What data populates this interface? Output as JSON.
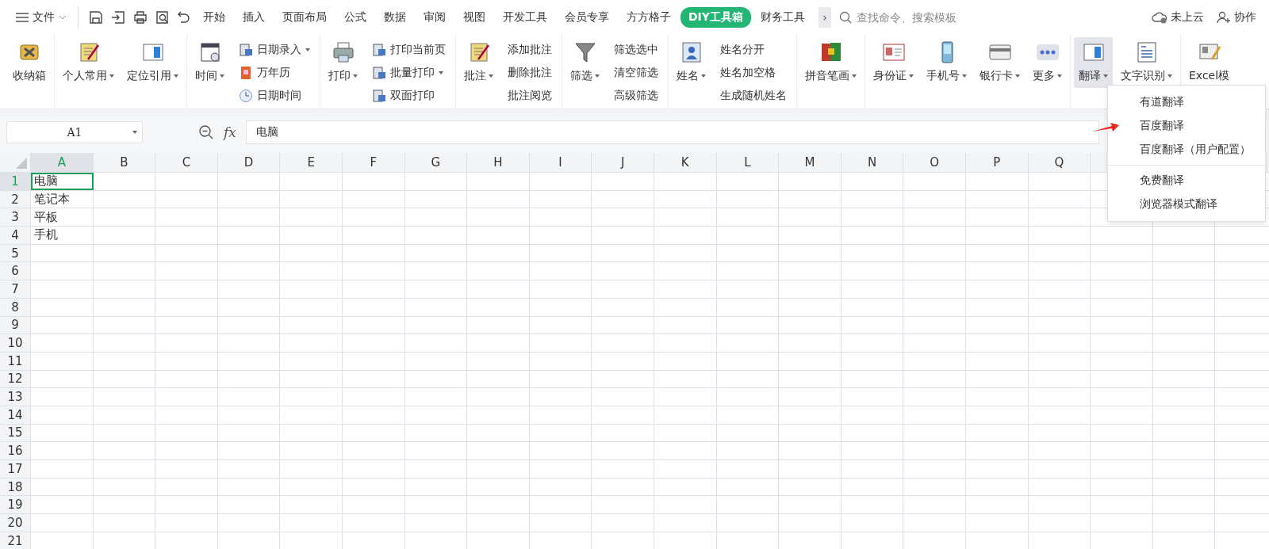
{
  "menu_bar": {
    "file_label": "文件",
    "tabs": [
      {
        "label": "开始",
        "selected": false
      },
      {
        "label": "插入",
        "selected": false
      },
      {
        "label": "页面布局",
        "selected": false
      },
      {
        "label": "公式",
        "selected": false
      },
      {
        "label": "数据",
        "selected": false
      },
      {
        "label": "审阅",
        "selected": false
      },
      {
        "label": "视图",
        "selected": false
      },
      {
        "label": "开发工具",
        "selected": false
      },
      {
        "label": "会员专享",
        "selected": false
      },
      {
        "label": "方方格子",
        "selected": false
      },
      {
        "label": "DIY工具箱",
        "selected": true
      },
      {
        "label": "财务工具",
        "selected": false
      }
    ],
    "more": "›",
    "search": {
      "placeholder": "查找命令、搜索模板"
    },
    "cloud": "未上云",
    "collab": "协作"
  },
  "ribbon": {
    "groups": [
      {
        "items": [
          {
            "kind": "large",
            "label": "收纳箱",
            "dropdown": false,
            "pressed": false
          }
        ]
      },
      {
        "items": [
          {
            "kind": "large",
            "label": "个人常用",
            "dropdown": true,
            "pressed": false
          },
          {
            "kind": "large",
            "label": "定位引用",
            "dropdown": true,
            "pressed": false
          }
        ]
      },
      {
        "items": [
          {
            "kind": "large",
            "label": "时间",
            "dropdown": true,
            "pressed": false
          },
          {
            "kind": "icon_stack",
            "rows": [
              {
                "label": "日期录入",
                "dropdown": true
              },
              {
                "label": "万年历",
                "dropdown": false
              },
              {
                "label": "日期时间",
                "dropdown": false
              }
            ]
          }
        ]
      },
      {
        "items": [
          {
            "kind": "large",
            "label": "打印",
            "dropdown": true,
            "pressed": false
          },
          {
            "kind": "icon_stack",
            "rows": [
              {
                "label": "打印当前页",
                "dropdown": false
              },
              {
                "label": "批量打印",
                "dropdown": true
              },
              {
                "label": "双面打印",
                "dropdown": false
              }
            ]
          }
        ]
      },
      {
        "items": [
          {
            "kind": "large",
            "label": "批注",
            "dropdown": true,
            "pressed": false
          },
          {
            "kind": "text_stack",
            "rows": [
              {
                "label": "添加批注",
                "dropdown": false
              },
              {
                "label": "删除批注",
                "dropdown": false
              },
              {
                "label": "批注阅览",
                "dropdown": false
              }
            ]
          }
        ]
      },
      {
        "items": [
          {
            "kind": "large",
            "label": "筛选",
            "dropdown": true,
            "pressed": false
          },
          {
            "kind": "text_stack",
            "rows": [
              {
                "label": "筛选选中",
                "dropdown": false
              },
              {
                "label": "清空筛选",
                "dropdown": false
              },
              {
                "label": "高级筛选",
                "dropdown": false
              }
            ]
          }
        ]
      },
      {
        "items": [
          {
            "kind": "large",
            "label": "姓名",
            "dropdown": true,
            "pressed": false
          },
          {
            "kind": "text_stack",
            "rows": [
              {
                "label": "姓名分开",
                "dropdown": false
              },
              {
                "label": "姓名加空格",
                "dropdown": false
              },
              {
                "label": "生成随机姓名",
                "dropdown": false
              }
            ]
          }
        ]
      },
      {
        "items": [
          {
            "kind": "large",
            "label": "拼音笔画",
            "dropdown": true,
            "pressed": false
          }
        ]
      },
      {
        "items": [
          {
            "kind": "large",
            "label": "身份证",
            "dropdown": true,
            "pressed": false
          },
          {
            "kind": "large",
            "label": "手机号",
            "dropdown": true,
            "pressed": false
          },
          {
            "kind": "large",
            "label": "银行卡",
            "dropdown": true,
            "pressed": false
          },
          {
            "kind": "large",
            "label": "更多",
            "dropdown": true,
            "pressed": false
          }
        ]
      },
      {
        "items": [
          {
            "kind": "large",
            "label": "翻译",
            "dropdown": true,
            "pressed": true
          },
          {
            "kind": "large",
            "label": "文字识别",
            "dropdown": true,
            "pressed": false
          }
        ]
      },
      {
        "items": [
          {
            "kind": "large",
            "label": "Excel模",
            "dropdown": false,
            "pressed": false
          }
        ]
      }
    ]
  },
  "formula_bar": {
    "name_box": "A1",
    "fx": "fx",
    "formula": "电脑"
  },
  "grid": {
    "columns": [
      {
        "label": "A",
        "selected": true
      },
      {
        "label": "B",
        "selected": false
      },
      {
        "label": "C",
        "selected": false
      },
      {
        "label": "D",
        "selected": false
      },
      {
        "label": "E",
        "selected": false
      },
      {
        "label": "F",
        "selected": false
      },
      {
        "label": "G",
        "selected": false
      },
      {
        "label": "H",
        "selected": false
      },
      {
        "label": "I",
        "selected": false
      },
      {
        "label": "J",
        "selected": false
      },
      {
        "label": "K",
        "selected": false
      },
      {
        "label": "L",
        "selected": false
      },
      {
        "label": "M",
        "selected": false
      },
      {
        "label": "N",
        "selected": false
      },
      {
        "label": "O",
        "selected": false
      },
      {
        "label": "P",
        "selected": false
      },
      {
        "label": "Q",
        "selected": false
      }
    ],
    "rows": [
      {
        "label": "1",
        "selected": true,
        "cells": [
          "电脑"
        ]
      },
      {
        "label": "2",
        "selected": false,
        "cells": [
          "笔记本"
        ]
      },
      {
        "label": "3",
        "selected": false,
        "cells": [
          "平板"
        ]
      },
      {
        "label": "4",
        "selected": false,
        "cells": [
          "手机"
        ]
      },
      {
        "label": "5",
        "selected": false,
        "cells": []
      },
      {
        "label": "6",
        "selected": false,
        "cells": []
      },
      {
        "label": "7",
        "selected": false,
        "cells": []
      },
      {
        "label": "8",
        "selected": false,
        "cells": []
      },
      {
        "label": "9",
        "selected": false,
        "cells": []
      },
      {
        "label": "10",
        "selected": false,
        "cells": []
      },
      {
        "label": "11",
        "selected": false,
        "cells": []
      },
      {
        "label": "12",
        "selected": false,
        "cells": []
      },
      {
        "label": "13",
        "selected": false,
        "cells": []
      },
      {
        "label": "14",
        "selected": false,
        "cells": []
      },
      {
        "label": "15",
        "selected": false,
        "cells": []
      },
      {
        "label": "16",
        "selected": false,
        "cells": []
      },
      {
        "label": "17",
        "selected": false,
        "cells": []
      },
      {
        "label": "18",
        "selected": false,
        "cells": []
      },
      {
        "label": "19",
        "selected": false,
        "cells": []
      },
      {
        "label": "20",
        "selected": false,
        "cells": []
      },
      {
        "label": "21",
        "selected": false,
        "cells": []
      }
    ]
  },
  "dropdown_menu": {
    "sections": [
      [
        "有道翻译",
        "百度翻译",
        "百度翻译（用户配置）"
      ],
      [
        "免费翻译",
        "浏览器模式翻译"
      ]
    ]
  }
}
